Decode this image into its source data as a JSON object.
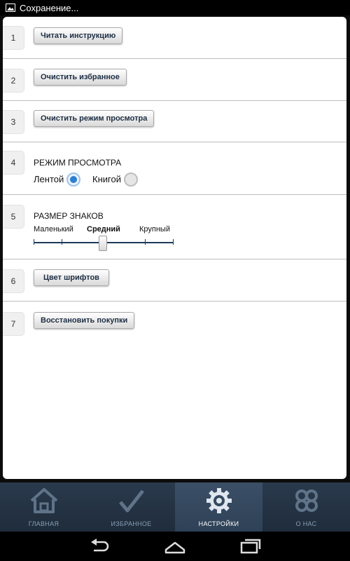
{
  "status_bar": {
    "text": "Сохранение..."
  },
  "settings": {
    "rows": [
      {
        "num": "1",
        "button": "Читать инструкцию"
      },
      {
        "num": "2",
        "button": "Очистить избранное"
      },
      {
        "num": "3",
        "button": "Очистить режим просмотра"
      },
      {
        "num": "4",
        "title": "РЕЖИМ ПРОСМОТРА",
        "options": [
          {
            "label": "Лентой",
            "checked": true
          },
          {
            "label": "Книгой",
            "checked": false
          }
        ]
      },
      {
        "num": "5",
        "title": "РАЗМЕР ЗНАКОВ",
        "sizes": [
          "Маленький",
          "Средний",
          "Крупный"
        ],
        "selected": "Средний"
      },
      {
        "num": "6",
        "button": "Цвет шрифтов"
      },
      {
        "num": "7",
        "button": "Восстановить покупки"
      }
    ]
  },
  "tabs": [
    {
      "label": "ГЛАВНАЯ",
      "icon": "home-icon",
      "active": false
    },
    {
      "label": "ИЗБРАННОЕ",
      "icon": "checkmark-icon",
      "active": false
    },
    {
      "label": "НАСТРОЙКИ",
      "icon": "gear-icon",
      "active": true
    },
    {
      "label": "О НАС",
      "icon": "clover-icon",
      "active": false
    }
  ],
  "nav": [
    "back-icon",
    "home-icon",
    "recent-apps-icon"
  ],
  "colors": {
    "tabbar": "#24344a",
    "accent": "#2e7ed1",
    "button_text": "#1d2e44"
  }
}
